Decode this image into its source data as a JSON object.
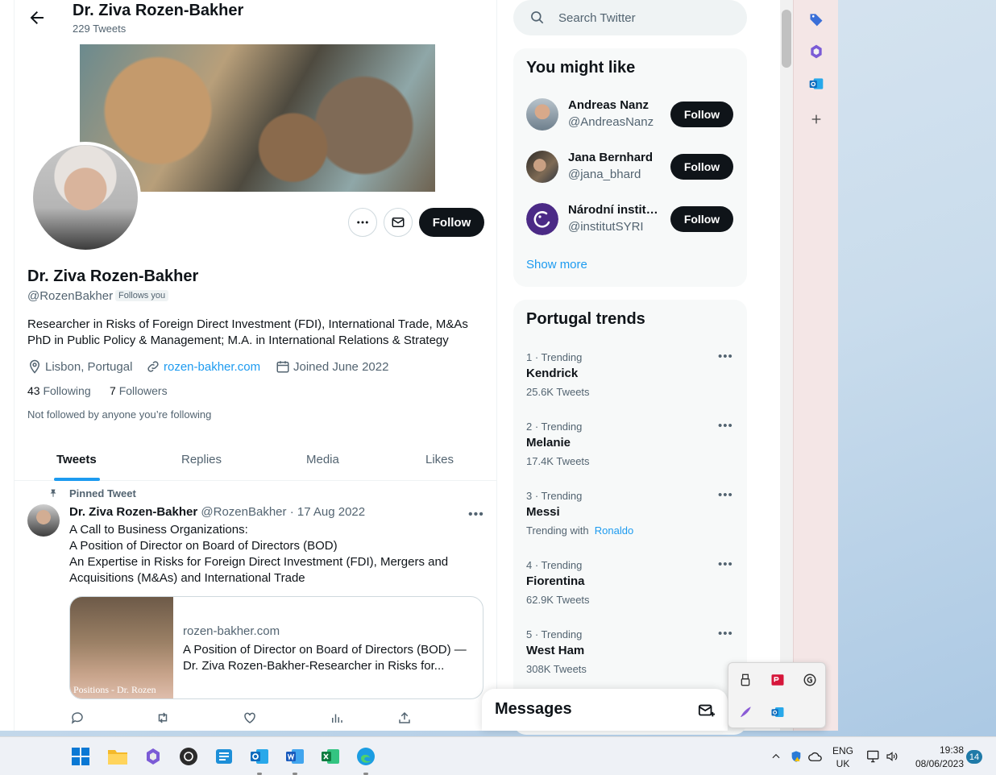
{
  "header": {
    "name": "Dr. Ziva Rozen-Bakher",
    "tweet_count": "229 Tweets"
  },
  "profile": {
    "name": "Dr. Ziva Rozen-Bakher",
    "handle": "@RozenBakher",
    "follows_you": "Follows you",
    "follow_label": "Follow",
    "bio_line1": "Researcher in Risks of Foreign Direct Investment (FDI), International Trade, M&As",
    "bio_line2": "PhD in Public Policy & Management; M.A. in International Relations & Strategy",
    "location": "Lisbon, Portugal",
    "website": "rozen-bakher.com",
    "joined": "Joined June 2022",
    "following_count": "43",
    "following_label": "Following",
    "followers_count": "7",
    "followers_label": "Followers",
    "not_followed": "Not followed by anyone you’re following"
  },
  "tabs": [
    {
      "label": "Tweets",
      "active": true
    },
    {
      "label": "Replies"
    },
    {
      "label": "Media"
    },
    {
      "label": "Likes"
    }
  ],
  "tweet": {
    "pinned_label": "Pinned Tweet",
    "author": "Dr. Ziva Rozen-Bakher",
    "handle": "@RozenBakher",
    "date": "· 17 Aug 2022",
    "lines": [
      "A Call to Business Organizations:",
      "A Position of Director on Board of Directors (BOD)",
      "An Expertise in Risks for Foreign Direct Investment (FDI), Mergers and",
      "Acquisitions (M&As) and International Trade"
    ],
    "card": {
      "image_text": "Positions - Dr. Rozen",
      "domain": "rozen-bakher.com",
      "title": "A Position of Director on Board of Directors (BOD) — Dr. Ziva Rozen-Bakher-Researcher in Risks for..."
    }
  },
  "search": {
    "placeholder": "Search Twitter"
  },
  "who_to_follow": {
    "title": "You might like",
    "users": [
      {
        "name": "Andreas Nanz",
        "handle": "@AndreasNanz",
        "button": "Follow"
      },
      {
        "name": "Jana Bernhard",
        "handle": "@jana_bhard",
        "button": "Follow"
      },
      {
        "name": "Národní institut SYRI",
        "handle": "@institutSYRI",
        "button": "Follow"
      }
    ],
    "show_more": "Show more"
  },
  "trends": {
    "title": "Portugal trends",
    "items": [
      {
        "meta": "1 · Trending",
        "name": "Kendrick",
        "sub": "25.6K Tweets"
      },
      {
        "meta": "2 · Trending",
        "name": "Melanie",
        "sub": "17.4K Tweets"
      },
      {
        "meta": "3 · Trending",
        "name": "Messi",
        "sub": "Trending with",
        "sub_link": "Ronaldo"
      },
      {
        "meta": "4 · Trending",
        "name": "Fiorentina",
        "sub": "62.9K Tweets"
      },
      {
        "meta": "5 · Trending",
        "name": "West Ham",
        "sub": "308K Tweets"
      }
    ]
  },
  "messages": {
    "title": "Messages"
  },
  "taskbar": {
    "lang_top": "ENG",
    "lang_bottom": "UK",
    "time": "19:38",
    "date": "08/06/2023",
    "notifications": "14"
  },
  "colors": {
    "accent": "#1d9bf0",
    "button_dark": "#0f1419",
    "secondary_text": "#536471"
  }
}
